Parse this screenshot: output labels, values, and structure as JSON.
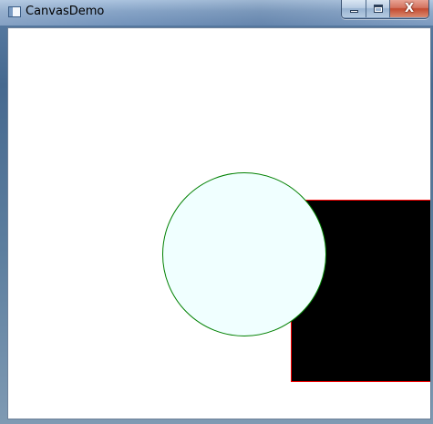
{
  "window": {
    "title": "CanvasDemo",
    "app_icon": "window-app-icon",
    "controls": {
      "minimize_icon": "minimize-icon",
      "maximize_icon": "maximize-icon",
      "close_icon": "close-icon",
      "close_glyph": "X"
    }
  },
  "canvas": {
    "background": "#ffffff",
    "shapes": [
      {
        "kind": "rectangle",
        "fill": "#000000",
        "stroke": "#ff0000"
      },
      {
        "kind": "ellipse",
        "fill": "#f0ffff",
        "stroke": "#008000"
      }
    ]
  }
}
